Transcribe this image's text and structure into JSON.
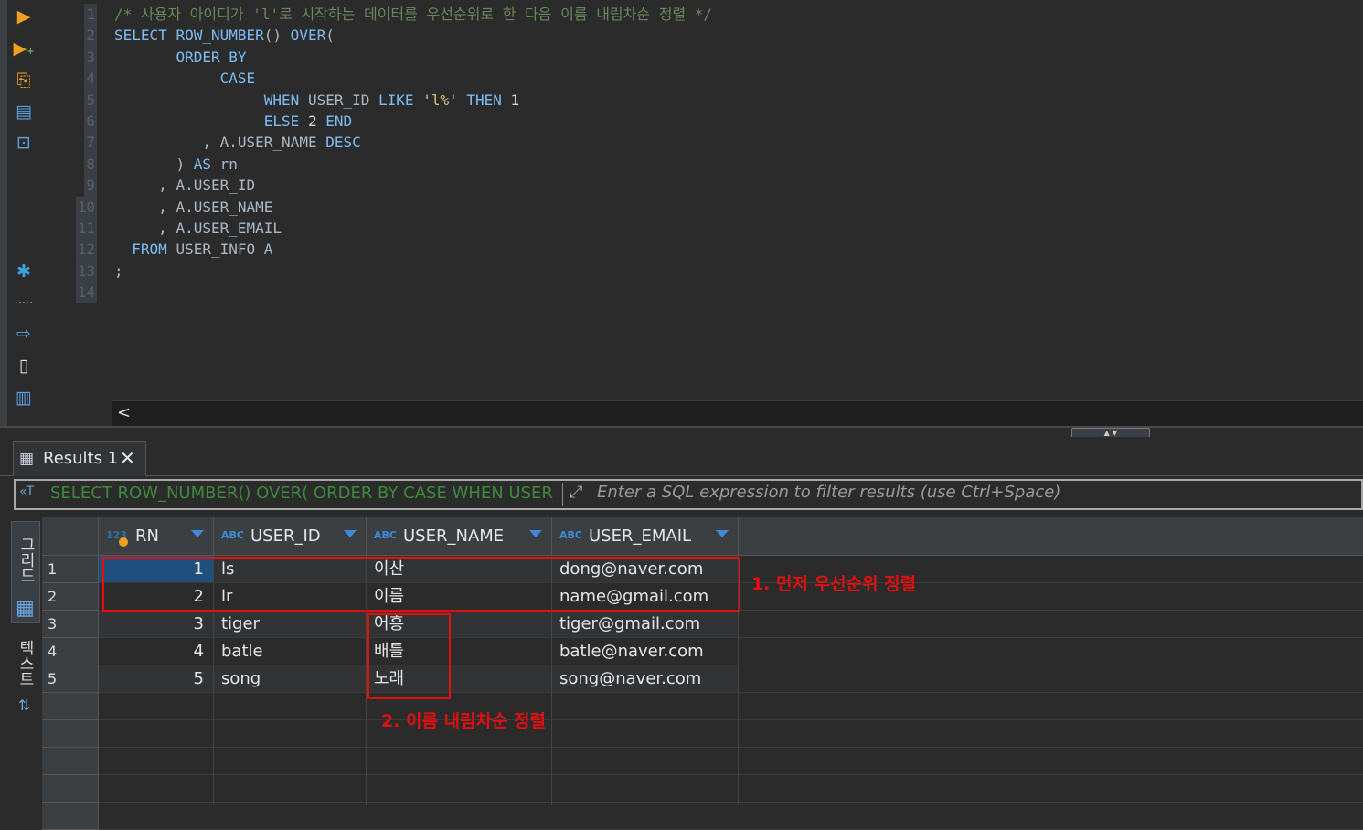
{
  "toolbar": {
    "icons": [
      "execute-icon",
      "execute-script-icon",
      "explain-plan-icon",
      "load-plan-icon",
      "console-icon",
      "settings-icon",
      "more-icon",
      "export-icon",
      "import-icon",
      "outline-icon"
    ],
    "more_label": "....."
  },
  "editor": {
    "lines": [
      {
        "n": "1",
        "text": "/* 사용자 아이디가 'l'로 시작하는 데이터를 우선순위로 한 다음 이름 내림차순 정렬 */"
      },
      {
        "n": "2",
        "text": "SELECT ROW_NUMBER() OVER("
      },
      {
        "n": "3",
        "text": "       ORDER BY"
      },
      {
        "n": "4",
        "text": "            CASE"
      },
      {
        "n": "5",
        "text": "                 WHEN USER_ID LIKE 'l%' THEN 1"
      },
      {
        "n": "6",
        "text": "                 ELSE 2 END"
      },
      {
        "n": "7",
        "text": "          , A.USER_NAME DESC"
      },
      {
        "n": "8",
        "text": "       ) AS rn"
      },
      {
        "n": "9",
        "text": "     , A.USER_ID"
      },
      {
        "n": "10",
        "text": "     , A.USER_NAME"
      },
      {
        "n": "11",
        "text": "     , A.USER_EMAIL"
      },
      {
        "n": "12",
        "text": "  FROM USER_INFO A"
      },
      {
        "n": "13",
        "text": ";"
      },
      {
        "n": "14",
        "text": ""
      }
    ],
    "scroll_left": "<"
  },
  "results": {
    "tab_label": "Results 1",
    "close": "✕",
    "filter_sql": "SELECT ROW_NUMBER() OVER( ORDER BY CASE WHEN USER_ID",
    "filter_placeholder": "Enter a SQL expression to filter results (use Ctrl+Space)",
    "side_tab_grid": "그리드",
    "side_tab_text": "텍스트",
    "columns": [
      {
        "type": "123",
        "name": "RN"
      },
      {
        "type": "ABC",
        "name": "USER_ID"
      },
      {
        "type": "ABC",
        "name": "USER_NAME"
      },
      {
        "type": "ABC",
        "name": "USER_EMAIL"
      }
    ],
    "rows": [
      {
        "idx": "1",
        "rn": "1",
        "user_id": "ls",
        "user_name": "이산",
        "user_email": "dong@naver.com"
      },
      {
        "idx": "2",
        "rn": "2",
        "user_id": "lr",
        "user_name": "이름",
        "user_email": "name@gmail.com"
      },
      {
        "idx": "3",
        "rn": "3",
        "user_id": "tiger",
        "user_name": "어흥",
        "user_email": "tiger@gmail.com"
      },
      {
        "idx": "4",
        "rn": "4",
        "user_id": "batle",
        "user_name": "배틀",
        "user_email": "batle@naver.com"
      },
      {
        "idx": "5",
        "rn": "5",
        "user_id": "song",
        "user_name": "노래",
        "user_email": "song@naver.com"
      }
    ]
  },
  "annotations": {
    "first": "1. 먼저 우선순위 정렬",
    "second": "2. 이름 내림차순 정렬",
    "color": "#e01010"
  },
  "colors": {
    "keyword": "#7cbcf6",
    "comment": "#6a8759",
    "string": "#d8c27b",
    "selection": "#1e4f7d"
  }
}
